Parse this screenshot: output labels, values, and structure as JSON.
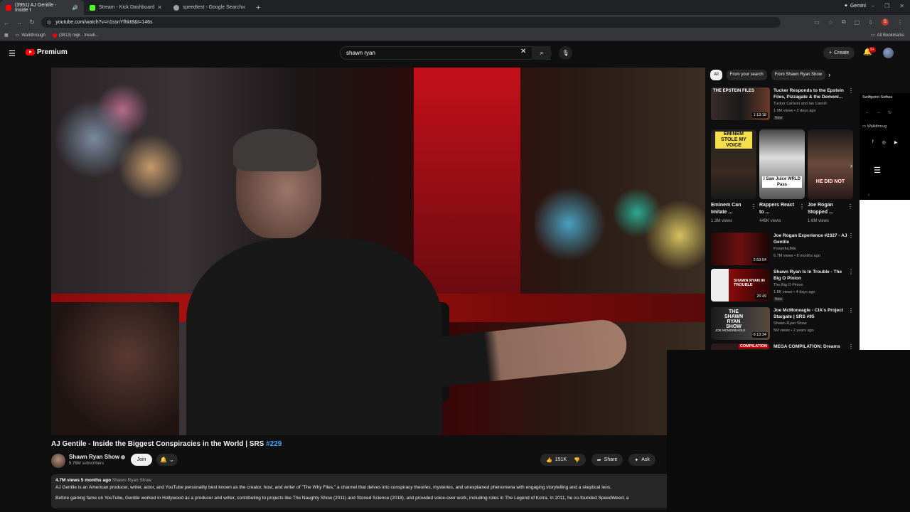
{
  "browser": {
    "tabs": [
      {
        "title": "(3951) AJ Gentile - Inside t",
        "favicon_color": "#ff0000",
        "active": true
      },
      {
        "title": "Stream - Kick Dashboard",
        "favicon_color": "#53fc18",
        "active": false
      },
      {
        "title": "speedtest - Google Search",
        "favicon_color": "#9aa0a6",
        "active": false
      }
    ],
    "gemini_label": "Gemini",
    "url": "youtube.com/watch?v=n1ssnYfhkt8&t=146s",
    "profile_initial": "S",
    "bookmarks": [
      {
        "label": "Walkthrough"
      },
      {
        "label": "(3813) mgk - treadi..."
      }
    ],
    "all_bookmarks": "All Bookmarks"
  },
  "youtube": {
    "logo_label": "Premium",
    "search_value": "shawn ryan",
    "create_label": "Create",
    "notif_badge": "9+",
    "video": {
      "title": "AJ Gentile - Inside the Biggest Conspiracies in the World | SRS ",
      "hashtag": "#229",
      "channel": "Shawn Ryan Show",
      "subscribers": "5.76M subscribers",
      "join_label": "Join",
      "likes": "151K",
      "share_label": "Share",
      "ask_label": "Ask",
      "views": "4.7M views",
      "age": "5 months ago",
      "channel_tag": "Shawn Ryan Show",
      "description_1": "AJ Gentile is an American producer, writer, actor, and YouTube personality best known as the creator, host, and writer of \"The Why Files,\" a channel that delves into conspiracy theories, mysteries, and unexplained phenomena with engaging storytelling and a skeptical lens.",
      "description_2": "Before gaining fame on YouTube, Gentile worked in Hollywood as a producer and writer, contributing to projects like The Naughty Show (2011) and Stoned Science (2018), and provided voice-over work, including roles in The Legend of Korra. In 2011, he co-founded SpeedWeed, a"
    },
    "chips": [
      "All",
      "From your search",
      "From Shawn Ryan Show"
    ],
    "recommended": [
      {
        "title": "Tucker Responds to the Epstein Files, Pizzagate & the Demoni...",
        "channel": "Tucker Carlson and Ian Carroll",
        "views": "1.9M views • 2 days ago",
        "duration": "1:13:18",
        "badge": "New"
      },
      {
        "title": "Joe Rogan Experience #2327 - AJ Gentile",
        "channel": "PowerfulJRE",
        "views": "6.7M views • 8 months ago",
        "duration": "2:53:54",
        "badge": ""
      },
      {
        "title": "Shawn Ryan Is In Trouble - The Big O Pinion",
        "channel": "The Big O Pinion",
        "views": "1.8K views • 4 days ago",
        "duration": "26:49",
        "badge": "New"
      },
      {
        "title": "Joe McMoneagle - CIA's Project Stargate | SRS #95",
        "channel": "Shawn Ryan Show",
        "views": "5M views • 2 years ago",
        "duration": "6:13:34",
        "badge": ""
      },
      {
        "title": "MEGA COMPILATION: Dreams",
        "channel": "",
        "views": "",
        "duration": "",
        "badge": ""
      }
    ],
    "shorts": [
      {
        "title": "Eminem Can Imitate ...",
        "views": "1.3M views",
        "overlay": "EMINEM STOLE MY VOICE"
      },
      {
        "title": "Rappers React to ...",
        "views": "449K views",
        "overlay": "I Saw Juice WRLD Pass"
      },
      {
        "title": "Joe Rogan Stopped ...",
        "views": "1.6M views",
        "overlay": "HE DID NOT"
      }
    ],
    "thumb_texts": {
      "t1": "THE EPSTEIN FILES",
      "t3": "SHAWN RYAN IN TROUBLE",
      "t4": "THE SHAWN RYAN SHOW",
      "t4b": "JOE MCMONEAGLE",
      "t5": "COMPILATION"
    }
  },
  "popup_window": {
    "title": "Swiftpoint Softwa",
    "walkthrough": "Walkthroug"
  }
}
